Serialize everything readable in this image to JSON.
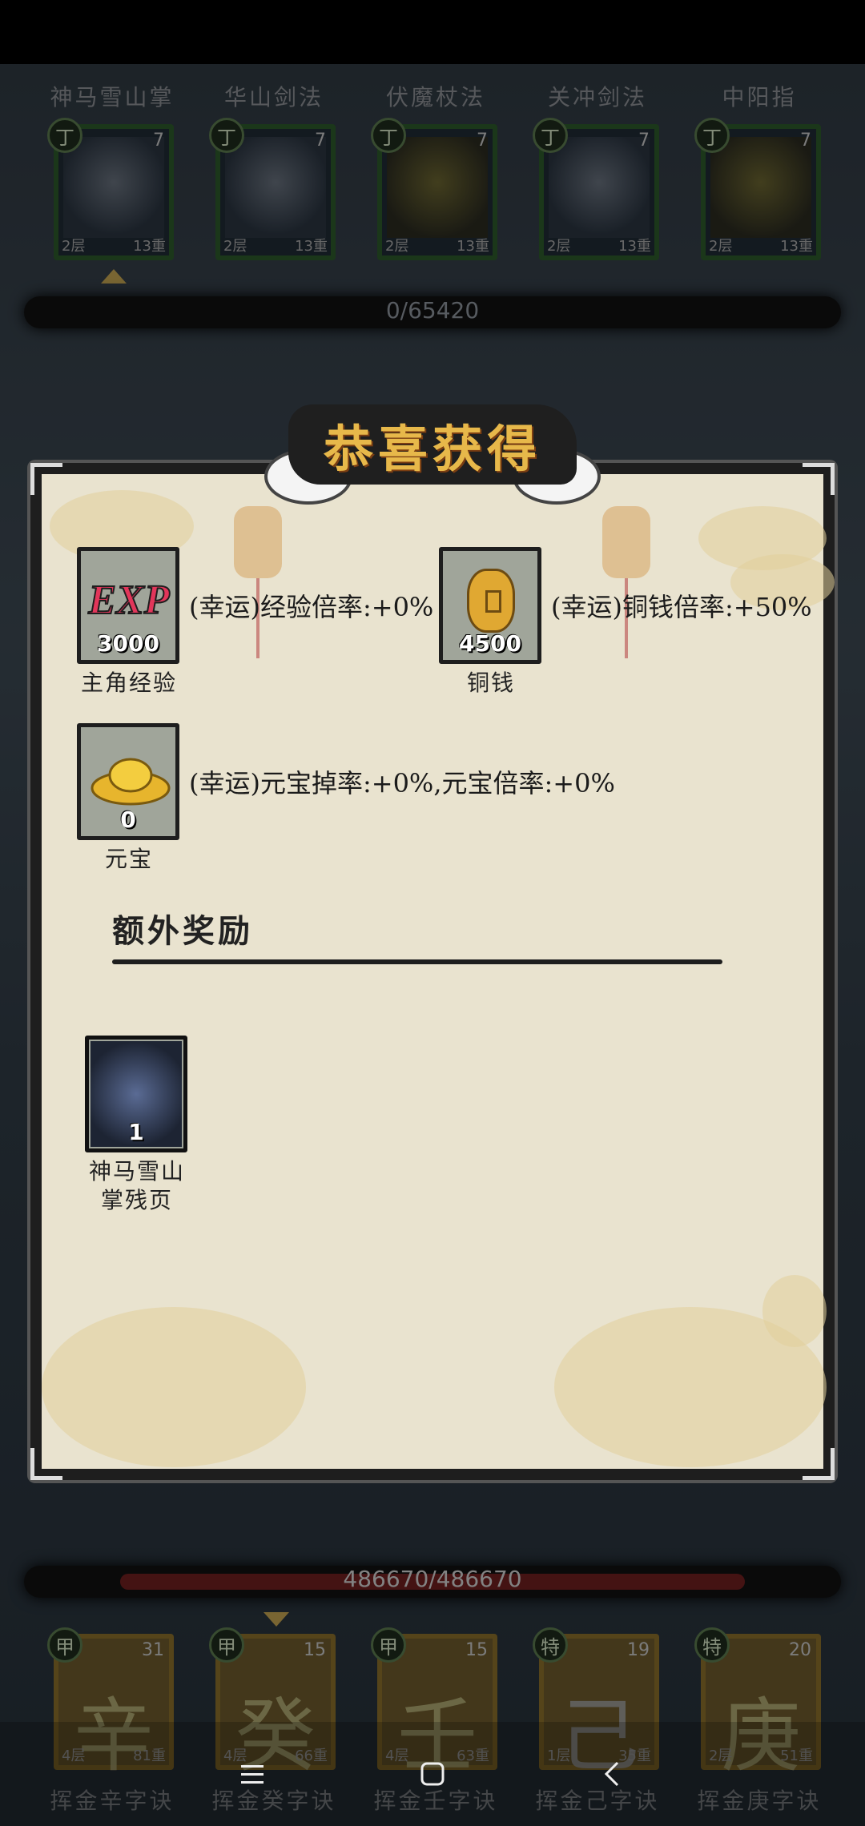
{
  "top_skills": [
    {
      "name": "神马雪山掌",
      "grade": "丁",
      "level": "7",
      "layer": "2层",
      "count": "13重"
    },
    {
      "name": "华山剑法",
      "grade": "丁",
      "level": "7",
      "layer": "2层",
      "count": "13重"
    },
    {
      "name": "伏魔杖法",
      "grade": "丁",
      "level": "7",
      "layer": "2层",
      "count": "13重"
    },
    {
      "name": "关冲剑法",
      "grade": "丁",
      "level": "7",
      "layer": "2层",
      "count": "13重"
    },
    {
      "name": "中阳指",
      "grade": "丁",
      "level": "7",
      "layer": "2层",
      "count": "13重"
    }
  ],
  "top_progress": "0/65420",
  "bottom_progress": "486670/486670",
  "bottom_skills": [
    {
      "name": "挥金辛字诀",
      "grade": "甲",
      "level": "31",
      "glyph": "辛",
      "layer": "4层",
      "count": "81重"
    },
    {
      "name": "挥金癸字诀",
      "grade": "甲",
      "level": "15",
      "glyph": "癸",
      "layer": "4层",
      "count": "66重"
    },
    {
      "name": "挥金壬字诀",
      "grade": "甲",
      "level": "15",
      "glyph": "壬",
      "layer": "4层",
      "count": "63重"
    },
    {
      "name": "挥金己字诀",
      "grade": "特",
      "level": "19",
      "glyph": "己",
      "layer": "1层",
      "count": "35重"
    },
    {
      "name": "挥金庚字诀",
      "grade": "特",
      "level": "20",
      "glyph": "庚",
      "layer": "2层",
      "count": "51重"
    }
  ],
  "popup": {
    "title": "恭喜获得",
    "rewards": [
      {
        "label": "主角经验",
        "amount": "3000",
        "icon": "exp-icon",
        "rate": "(幸运)经验倍率:+0%"
      },
      {
        "label": "铜钱",
        "amount": "4500",
        "icon": "copper-coin-icon",
        "rate": "(幸运)铜钱倍率:+50%"
      },
      {
        "label": "元宝",
        "amount": "0",
        "icon": "gold-ingot-icon",
        "rate": "(幸运)元宝掉率:+0%,元宝倍率:+0%"
      }
    ],
    "extra_title": "额外奖励",
    "extra_items": [
      {
        "label_line1": "神马雪山",
        "label_line2": "掌残页",
        "amount": "1",
        "icon": "manual-page-icon"
      }
    ]
  },
  "colors": {
    "popup_bg": "#e9e3cf",
    "title_gold": "#e7b84a",
    "frame_green": "#2d5a2a",
    "frame_gold": "#8a6f2a"
  }
}
